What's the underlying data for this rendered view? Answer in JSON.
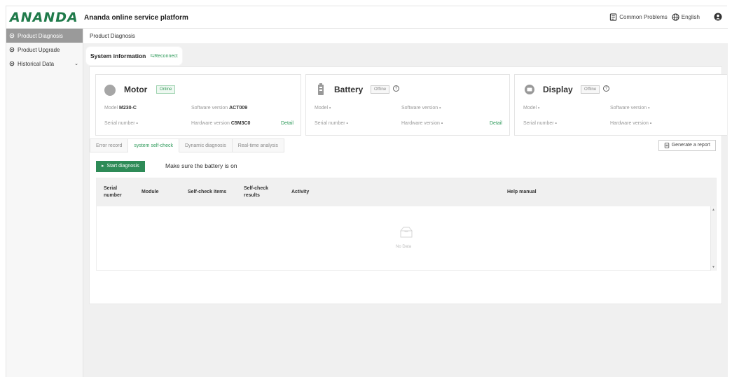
{
  "header": {
    "logo": "ANANDA",
    "title": "Ananda online service platform",
    "common_problems": "Common Problems",
    "language": "English"
  },
  "sidebar": {
    "items": [
      {
        "label": "Product Diagnosis",
        "icon": "gear-icon"
      },
      {
        "label": "Product Upgrade",
        "icon": "gear-icon"
      },
      {
        "label": "Historical Data",
        "icon": "gear-icon"
      }
    ]
  },
  "breadcrumb": "Product Diagnosis",
  "system_info": {
    "title": "System information",
    "reconnect": "⇆Reconnect"
  },
  "cards": {
    "motor": {
      "name": "Motor",
      "status": "Online",
      "model_label": "Model",
      "model_value": "M230-C",
      "software_label": "Software version",
      "software_value": "ACT009",
      "serial_label": "Serial number",
      "serial_value": "-",
      "hardware_label": "Hardware version",
      "hardware_value": "C5M3C0",
      "detail": "Detail"
    },
    "battery": {
      "name": "Battery",
      "status": "Offline",
      "model_label": "Model",
      "model_value": "-",
      "software_label": "Software version",
      "software_value": "-",
      "serial_label": "Serial number",
      "serial_value": "-",
      "hardware_label": "Hardware version",
      "hardware_value": "-",
      "detail": "Detail"
    },
    "display": {
      "name": "Display",
      "status": "Offline",
      "model_label": "Model",
      "model_value": "-",
      "software_label": "Software version",
      "software_value": "-",
      "serial_label": "Serial number",
      "serial_value": "-",
      "hardware_label": "Hardware version",
      "hardware_value": "-"
    }
  },
  "tabs": [
    "Error record",
    "system self-check",
    "Dynamic diagnosis",
    "Real-time analysis"
  ],
  "generate_report": "Generate a report",
  "start_diagnosis": "Start diagnosis",
  "battery_note": "Make sure the battery is on",
  "table": {
    "columns": [
      "Serial number",
      "Module",
      "Self-check items",
      "Self-check results",
      "Activity",
      "Help manual"
    ],
    "empty": "No Data"
  },
  "colors": {
    "brand": "#1f7a4a",
    "accent": "#2e9a5a",
    "button": "#2e8b57"
  }
}
